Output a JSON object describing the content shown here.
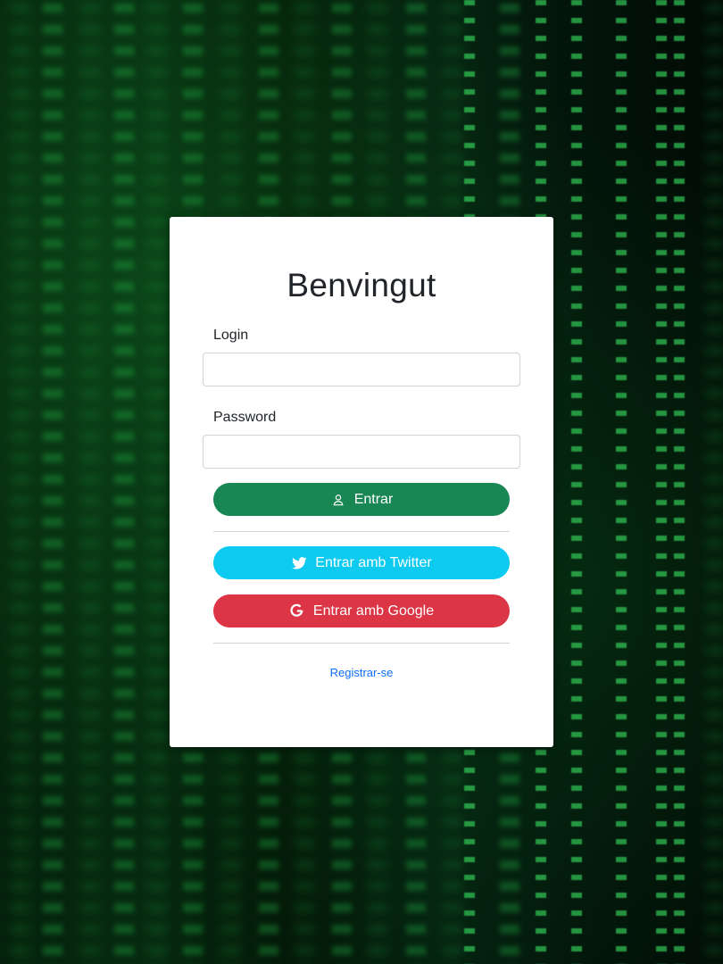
{
  "colors": {
    "primary": "#198754",
    "twitter": "#0dcaf0",
    "google": "#dc3545",
    "link": "#0d6efd",
    "card": "#ffffff"
  },
  "login_card": {
    "title": "Benvingut",
    "login_label": "Login",
    "login_value": "",
    "password_label": "Password",
    "password_value": "",
    "submit": {
      "label": "Entrar",
      "icon": "user-icon"
    },
    "twitter": {
      "label": "Entrar amb Twitter",
      "icon": "twitter-icon"
    },
    "google": {
      "label": "Entrar amb Google",
      "icon": "google-icon"
    },
    "register_link": "Registrar-se"
  }
}
